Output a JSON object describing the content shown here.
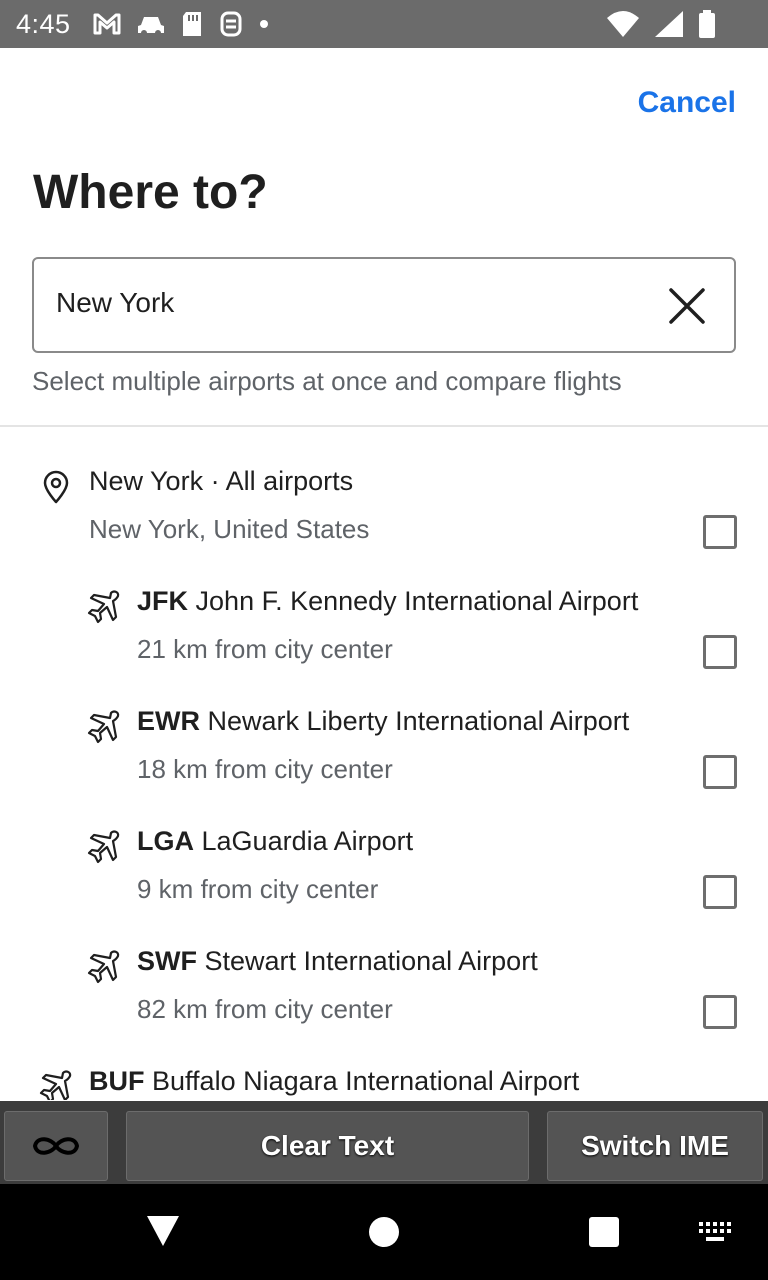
{
  "status_bar": {
    "time": "4:45",
    "left_icons": [
      "gmail-icon",
      "car-icon",
      "sd-card-icon",
      "sync-icon",
      "dot-icon"
    ],
    "right_icons": [
      "wifi-icon",
      "signal-icon",
      "battery-icon"
    ]
  },
  "header": {
    "cancel_label": "Cancel",
    "title": "Where to?"
  },
  "search": {
    "value": "New York",
    "helper": "Select multiple airports at once and compare flights"
  },
  "results": [
    {
      "icon": "location-pin-icon",
      "code": "",
      "name": "New York · All airports",
      "sub": "New York, United States",
      "checked": false
    },
    {
      "icon": "airplane-icon",
      "code": "JFK",
      "name": "John F. Kennedy International Airport",
      "sub": "21 km from city center",
      "checked": false
    },
    {
      "icon": "airplane-icon",
      "code": "EWR",
      "name": "Newark Liberty International Airport",
      "sub": "18 km from city center",
      "checked": false
    },
    {
      "icon": "airplane-icon",
      "code": "LGA",
      "name": "LaGuardia Airport",
      "sub": "9 km from city center",
      "checked": false
    },
    {
      "icon": "airplane-icon",
      "code": "SWF",
      "name": "Stewart International Airport",
      "sub": "82 km from city center",
      "checked": false
    },
    {
      "icon": "airplane-icon",
      "code": "BUF",
      "name": "Buffalo Niagara International Airport",
      "sub": "",
      "checked": false
    }
  ],
  "ime_bar": {
    "infinity_icon": "infinity-icon",
    "clear_label": "Clear Text",
    "switch_label": "Switch IME"
  },
  "nav_bar": {
    "icons": [
      "back-icon",
      "home-icon",
      "recents-icon",
      "keyboard-icon"
    ]
  },
  "colors": {
    "accent": "#1a73e8",
    "status_bar": "#6b6b6b",
    "ime_bar": "#3c3c3c"
  }
}
